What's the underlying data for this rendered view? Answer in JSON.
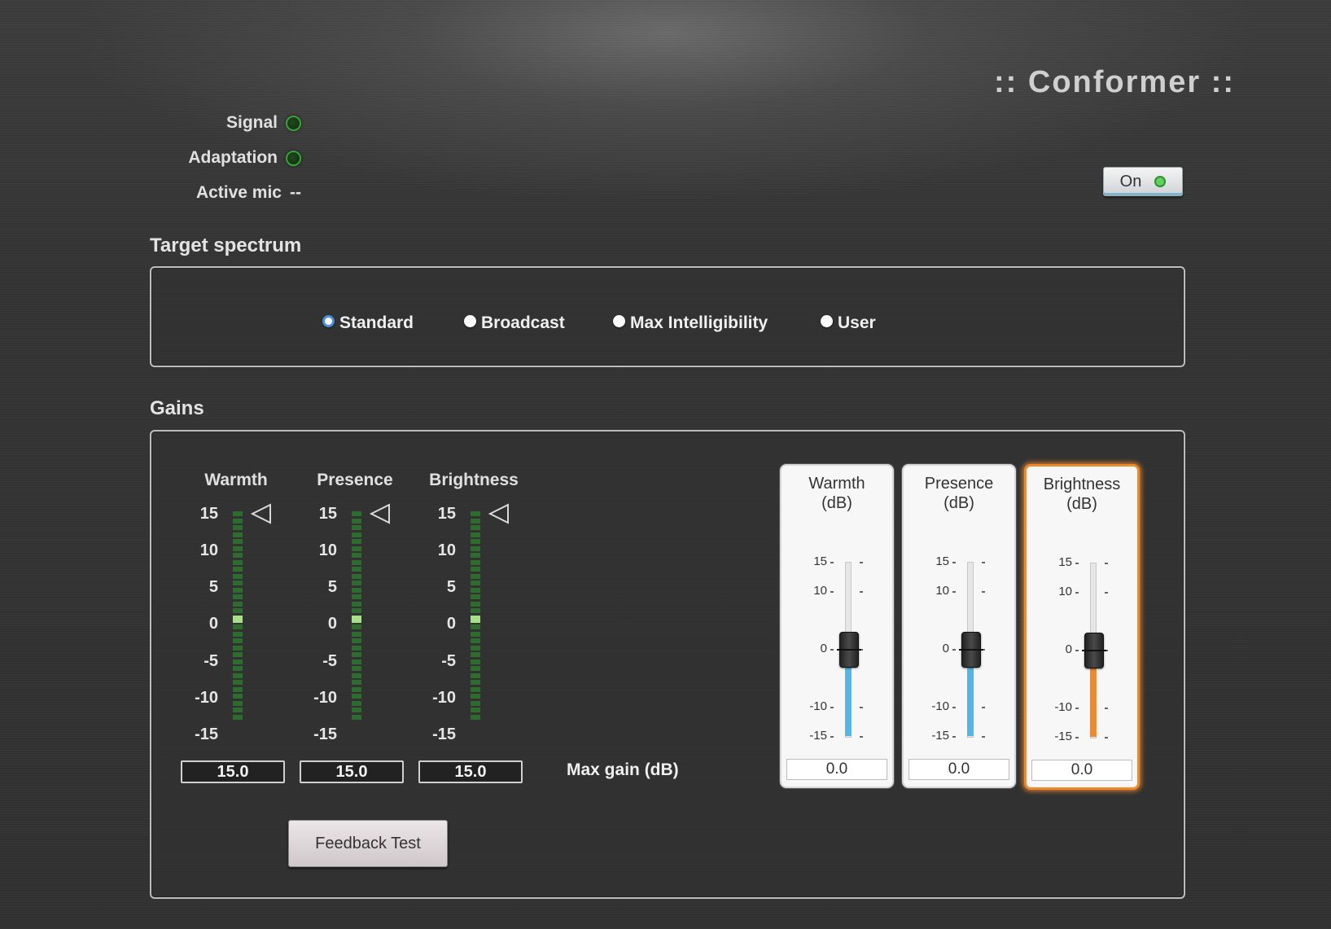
{
  "app": {
    "title": ":: Conformer ::"
  },
  "status": {
    "signal": {
      "label": "Signal",
      "led": "green"
    },
    "adaptation": {
      "label": "Adaptation",
      "led": "green"
    },
    "active_mic": {
      "label": "Active mic",
      "value": "--"
    }
  },
  "power": {
    "label": "On",
    "led_color": "#5fd35f"
  },
  "target_spectrum": {
    "title": "Target spectrum",
    "options": [
      {
        "label": "Standard",
        "selected": true
      },
      {
        "label": "Broadcast",
        "selected": false
      },
      {
        "label": "Max Intelligibility",
        "selected": false
      },
      {
        "label": "User",
        "selected": false
      }
    ]
  },
  "gains": {
    "title": "Gains",
    "meter_ticks": [
      "15",
      "10",
      "5",
      "0",
      "-5",
      "-10",
      "-15"
    ],
    "meters": [
      {
        "label": "Warmth",
        "max_gain": "15.0",
        "level": 0
      },
      {
        "label": "Presence",
        "max_gain": "15.0",
        "level": 0
      },
      {
        "label": "Brightness",
        "max_gain": "15.0",
        "level": 0
      }
    ],
    "max_gain_label": "Max gain (dB)",
    "feedback_button": "Feedback Test",
    "fader_ticks": [
      "15",
      "10",
      "0",
      "-10",
      "-15"
    ],
    "faders": [
      {
        "title_line1": "Warmth",
        "title_line2": "(dB)",
        "value": "0.0",
        "fill_color": "#5ab4e0",
        "focused": false
      },
      {
        "title_line1": "Presence",
        "title_line2": "(dB)",
        "value": "0.0",
        "fill_color": "#5ab4e0",
        "focused": false
      },
      {
        "title_line1": "Brightness",
        "title_line2": "(dB)",
        "value": "0.0",
        "fill_color": "#ee8a2e",
        "focused": true
      }
    ]
  }
}
